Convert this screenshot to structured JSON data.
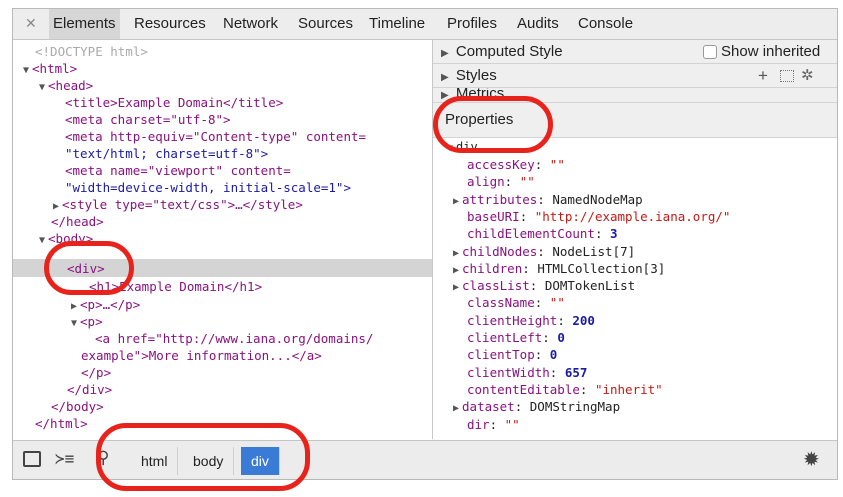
{
  "tabs": [
    "Elements",
    "Resources",
    "Network",
    "Sources",
    "Timeline",
    "Profiles",
    "Audits",
    "Console"
  ],
  "dom_lines": {
    "doctype": "<!DOCTYPE html>",
    "html_open": "<html>",
    "head_open": "<head>",
    "title": "<title>Example Domain</title>",
    "meta_charset": "<meta charset=\"utf-8\">",
    "meta_http1": "<meta http-equiv=\"Content-type\" content=",
    "meta_http2": "\"text/html; charset=utf-8\">",
    "meta_vp1": "<meta name=\"viewport\" content=",
    "meta_vp2": "\"width=device-width, initial-scale=1\">",
    "style": "<style type=\"text/css\">…</style>",
    "head_close": "</head>",
    "body_open": "<body>",
    "div_open": "<div>",
    "h1": "<h1>Example Domain</h1>",
    "p_collapsed": "<p>…</p>",
    "p_open": "<p>",
    "a1": "<a href=\"http://www.iana.org/domains/",
    "a2": "example\">More information...</a>",
    "p_close": "</p>",
    "div_close": "</div>",
    "body_close": "</body>",
    "html_close": "</html>"
  },
  "sections": {
    "computed_style": "Computed Style",
    "show_inherited": "Show inherited",
    "styles": "Styles",
    "metrics": "Metrics",
    "properties": "Properties",
    "div_group": "div"
  },
  "properties": [
    {
      "name": "accessKey",
      "value": "\"\"",
      "kind": "str",
      "expand": false
    },
    {
      "name": "align",
      "value": "\"\"",
      "kind": "str",
      "expand": false
    },
    {
      "name": "attributes",
      "value": "NamedNodeMap",
      "kind": "obj",
      "expand": true
    },
    {
      "name": "baseURI",
      "value": "\"http://example.iana.org/\"",
      "kind": "str",
      "expand": false
    },
    {
      "name": "childElementCount",
      "value": "3",
      "kind": "num",
      "expand": false
    },
    {
      "name": "childNodes",
      "value": "NodeList[7]",
      "kind": "obj",
      "expand": true
    },
    {
      "name": "children",
      "value": "HTMLCollection[3]",
      "kind": "obj",
      "expand": true
    },
    {
      "name": "classList",
      "value": "DOMTokenList",
      "kind": "obj",
      "expand": true
    },
    {
      "name": "className",
      "value": "\"\"",
      "kind": "str",
      "expand": false
    },
    {
      "name": "clientHeight",
      "value": "200",
      "kind": "num",
      "expand": false
    },
    {
      "name": "clientLeft",
      "value": "0",
      "kind": "num",
      "expand": false
    },
    {
      "name": "clientTop",
      "value": "0",
      "kind": "num",
      "expand": false
    },
    {
      "name": "clientWidth",
      "value": "657",
      "kind": "num",
      "expand": false
    },
    {
      "name": "contentEditable",
      "value": "\"inherit\"",
      "kind": "str",
      "expand": false
    },
    {
      "name": "dataset",
      "value": "DOMStringMap",
      "kind": "obj",
      "expand": true
    },
    {
      "name": "dir",
      "value": "\"\"",
      "kind": "str",
      "expand": false
    }
  ],
  "breadcrumbs": [
    "html",
    "body",
    "div"
  ],
  "colors": {
    "selected_crumb": "#3a7bd5",
    "annotation": "#e8231c"
  }
}
